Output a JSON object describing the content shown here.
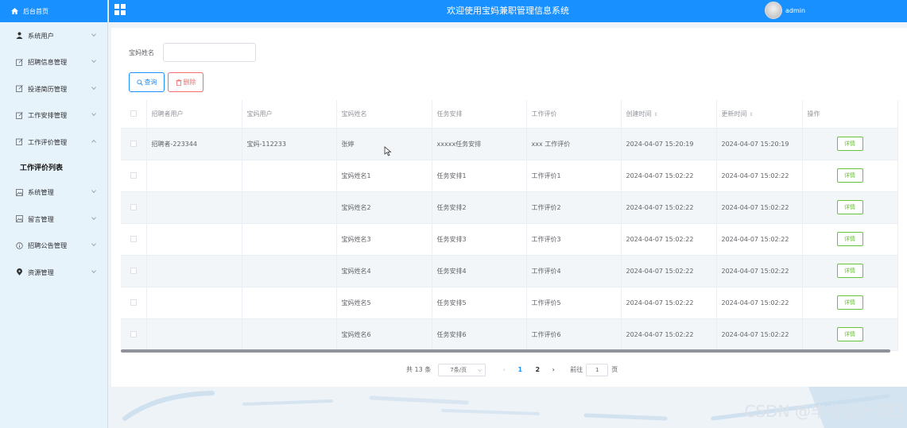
{
  "app": {
    "brand_label": "后台首页",
    "title": "欢迎使用宝妈兼职管理信息系统",
    "user_name": "admin"
  },
  "sidebar": {
    "items": [
      {
        "label": "系统用户",
        "icon": "user-icon",
        "expanded": false
      },
      {
        "label": "招聘信息管理",
        "icon": "edit-icon",
        "expanded": false
      },
      {
        "label": "投递简历管理",
        "icon": "edit-icon",
        "expanded": false
      },
      {
        "label": "工作安排管理",
        "icon": "edit-icon",
        "expanded": false
      },
      {
        "label": "工作评价管理",
        "icon": "edit-icon",
        "expanded": true
      },
      {
        "label": "系统管理",
        "icon": "picture-icon",
        "expanded": false
      },
      {
        "label": "留言管理",
        "icon": "picture-icon",
        "expanded": false
      },
      {
        "label": "招聘公告管理",
        "icon": "info-icon",
        "expanded": false
      },
      {
        "label": "资源管理",
        "icon": "location-icon",
        "expanded": false
      }
    ],
    "active_sub": "工作评价列表"
  },
  "search": {
    "label": "宝妈姓名",
    "value": "",
    "placeholder": ""
  },
  "buttons": {
    "search_label": "查询",
    "delete_label": "删除",
    "detail_label": "详情"
  },
  "table": {
    "headers": [
      "招聘者用户",
      "宝妈用户",
      "宝妈姓名",
      "任务安排",
      "工作评价",
      "创建时间",
      "更新时间",
      "操作"
    ],
    "rows": [
      [
        "招聘者-223344",
        "宝妈-112233",
        "张婷",
        "xxxxx任务安排",
        "xxx 工作评价",
        "2024-04-07 15:20:19",
        "2024-04-07 15:20:19"
      ],
      [
        "",
        "",
        "宝妈姓名1",
        "任务安排1",
        "工作评价1",
        "2024-04-07 15:02:22",
        "2024-04-07 15:02:22"
      ],
      [
        "",
        "",
        "宝妈姓名2",
        "任务安排2",
        "工作评价2",
        "2024-04-07 15:02:22",
        "2024-04-07 15:02:22"
      ],
      [
        "",
        "",
        "宝妈姓名3",
        "任务安排3",
        "工作评价3",
        "2024-04-07 15:02:22",
        "2024-04-07 15:02:22"
      ],
      [
        "",
        "",
        "宝妈姓名4",
        "任务安排4",
        "工作评价4",
        "2024-04-07 15:02:22",
        "2024-04-07 15:02:22"
      ],
      [
        "",
        "",
        "宝妈姓名5",
        "任务安排5",
        "工作评价5",
        "2024-04-07 15:02:22",
        "2024-04-07 15:02:22"
      ],
      [
        "",
        "",
        "宝妈姓名6",
        "任务安排6",
        "工作评价6",
        "2024-04-07 15:02:22",
        "2024-04-07 15:02:22"
      ]
    ]
  },
  "pagination": {
    "total": "共 13 条",
    "page_size": "7条/页",
    "pages": [
      "1",
      "2"
    ],
    "current_page": "1",
    "goto_label": "前往",
    "goto_value": "1",
    "goto_suffix": "页"
  },
  "watermark": "CSDN @毕业设计703",
  "colors": {
    "primary": "#1890ff",
    "danger": "#f56c6c",
    "success": "#67c23a",
    "sidebar_bg": "#e7f3fb"
  }
}
